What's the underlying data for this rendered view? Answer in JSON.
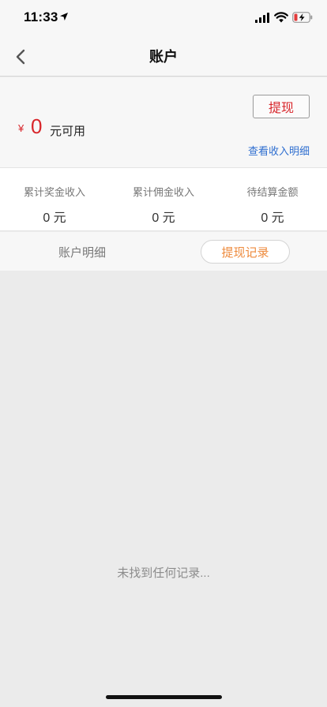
{
  "status_bar": {
    "time": "11:33"
  },
  "nav": {
    "title": "账户"
  },
  "balance": {
    "currency_symbol": "¥",
    "amount": "0",
    "unit_label": "元可用",
    "withdraw_button": "提现",
    "income_detail_link": "查看收入明细"
  },
  "stats": [
    {
      "label": "累计奖金收入",
      "value": "0 元"
    },
    {
      "label": "累计佣金收入",
      "value": "0 元"
    },
    {
      "label": "待结算金额",
      "value": "0 元"
    }
  ],
  "tabs": [
    {
      "label": "账户明细",
      "active": false
    },
    {
      "label": "提现记录",
      "active": true
    }
  ],
  "empty_state": {
    "message": "未找到任何记录..."
  },
  "colors": {
    "accent_red": "#d8262b",
    "link_blue": "#2f6fd0",
    "active_tab_orange": "#ee8a3c"
  }
}
